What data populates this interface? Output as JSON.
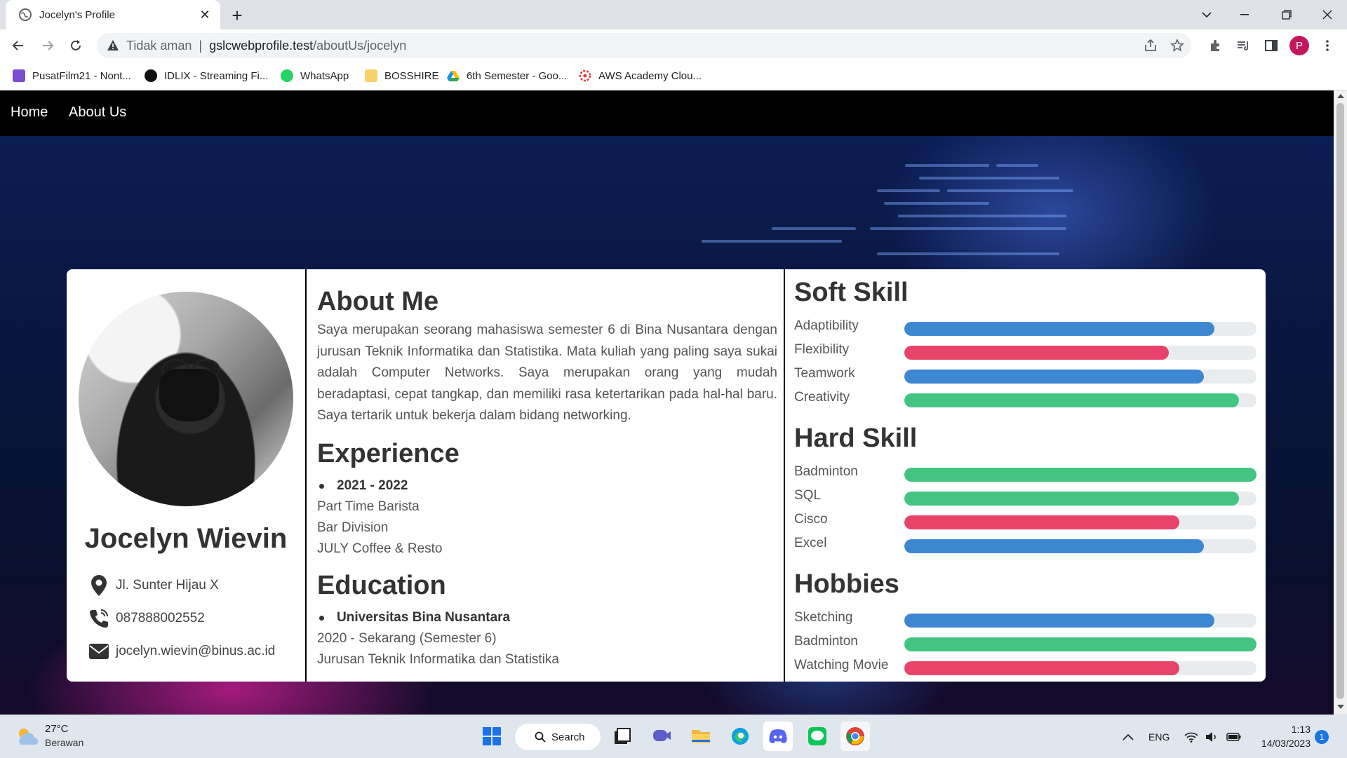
{
  "browser": {
    "tab_title": "Jocelyn's Profile",
    "security_label": "Tidak aman",
    "url_host": "gslcwebprofile.test",
    "url_path": "/aboutUs/jocelyn",
    "profile_initial": "P"
  },
  "bookmarks": [
    {
      "label": "PusatFilm21 - Nont...",
      "color": "#7b4bd1"
    },
    {
      "label": "IDLIX - Streaming Fi...",
      "color": "#111111"
    },
    {
      "label": "WhatsApp",
      "color": "#25d366"
    },
    {
      "label": "BOSSHIRE",
      "color": "#f6d36b"
    },
    {
      "label": "6th Semester - Goo...",
      "color": "#1e88e5"
    },
    {
      "label": "AWS Academy Clou...",
      "color": "#e53935"
    }
  ],
  "nav": {
    "home": "Home",
    "about": "About Us"
  },
  "profile": {
    "name": "Jocelyn Wievin",
    "address": "Jl. Sunter Hijau X",
    "phone": "087888002552",
    "email": "jocelyn.wievin@binus.ac.id"
  },
  "about": {
    "title": "About Me",
    "text": "Saya merupakan seorang mahasiswa semester 6 di Bina Nusantara dengan jurusan Teknik Informatika dan Statistika. Mata kuliah yang paling saya sukai adalah Computer Networks. Saya merupakan orang yang mudah beradaptasi, cepat tangkap, dan memiliki rasa ketertarikan pada hal-hal baru. Saya tertarik untuk bekerja dalam bidang networking."
  },
  "experience": {
    "title": "Experience",
    "period": "2021 - 2022",
    "role": "Part Time Barista",
    "division": "Bar Division",
    "company": "JULY Coffee & Resto"
  },
  "education": {
    "title": "Education",
    "school": "Universitas Bina Nusantara",
    "period": "2020 - Sekarang (Semester 6)",
    "major": "Jurusan Teknik Informatika dan Statistika"
  },
  "colors": {
    "blue": "#3d87d1",
    "red": "#e8436a",
    "green": "#42c581"
  },
  "soft_skill": {
    "title": "Soft Skill",
    "items": [
      {
        "label": "Adaptibility",
        "percent": 88,
        "color": "#3d87d1"
      },
      {
        "label": "Flexibility",
        "percent": 75,
        "color": "#e8436a"
      },
      {
        "label": "Teamwork",
        "percent": 85,
        "color": "#3d87d1"
      },
      {
        "label": "Creativity",
        "percent": 95,
        "color": "#42c581"
      }
    ]
  },
  "hard_skill": {
    "title": "Hard Skill",
    "items": [
      {
        "label": "Badminton",
        "percent": 100,
        "color": "#42c581"
      },
      {
        "label": "SQL",
        "percent": 95,
        "color": "#42c581"
      },
      {
        "label": "Cisco",
        "percent": 78,
        "color": "#e8436a"
      },
      {
        "label": "Excel",
        "percent": 85,
        "color": "#3d87d1"
      }
    ]
  },
  "hobbies": {
    "title": "Hobbies",
    "items": [
      {
        "label": "Sketching",
        "percent": 88,
        "color": "#3d87d1"
      },
      {
        "label": "Badminton",
        "percent": 100,
        "color": "#42c581"
      },
      {
        "label": "Watching Movie",
        "percent": 78,
        "color": "#e8436a"
      }
    ]
  },
  "taskbar": {
    "temperature": "27°C",
    "weather": "Berawan",
    "search_label": "Search",
    "language": "ENG",
    "time": "1:13",
    "date": "14/03/2023",
    "notifications": "1"
  }
}
